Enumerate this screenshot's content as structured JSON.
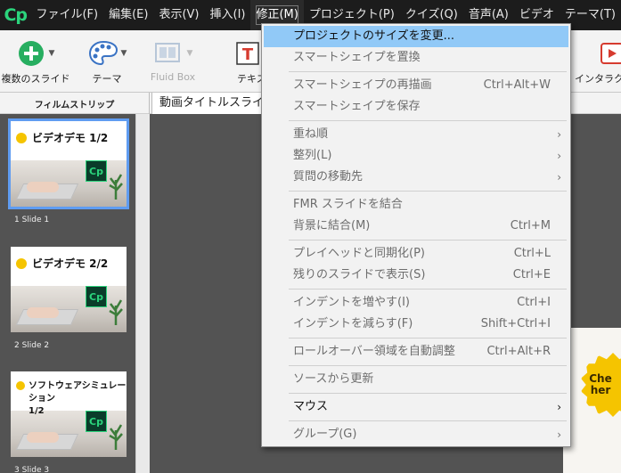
{
  "app": {
    "logo_text": "Cp"
  },
  "menubar": {
    "items": [
      {
        "label": "ファイル(F)"
      },
      {
        "label": "編集(E)"
      },
      {
        "label": "表示(V)"
      },
      {
        "label": "挿入(I)"
      },
      {
        "label": "修正(M)",
        "active": true
      },
      {
        "label": "プロジェクト(P)"
      },
      {
        "label": "クイズ(Q)"
      },
      {
        "label": "音声(A)"
      },
      {
        "label": "ビデオ"
      },
      {
        "label": "テーマ(T)"
      }
    ]
  },
  "toolbar": {
    "multi_slide_label": "複数のスライド",
    "theme_label": "テーマ",
    "fluid_box_label": "Fluid Box",
    "text_label": "テキスト",
    "interactive_label": "インタラクティ"
  },
  "subbar": {
    "filmstrip_header": "フィルムストリップ",
    "slide_tab": "動画タイトルスライド"
  },
  "filmstrip": {
    "slides": [
      {
        "title": "ビデオデモ 1/2",
        "label": "1 Slide 1",
        "selected": true
      },
      {
        "title": "ビデオデモ 2/2",
        "label": "2 Slide 2",
        "selected": false
      },
      {
        "title_line1": "ソフトウェアシミュレーション",
        "title_line2": "1/2",
        "label": "3 Slide 3",
        "selected": false
      }
    ],
    "badge_text": "Cp"
  },
  "canvas": {
    "badge_line1": "Che",
    "badge_line2": "her"
  },
  "dropdown": {
    "items": [
      {
        "label": "プロジェクトのサイズを変更...",
        "shortcut": "",
        "enabled": true,
        "highlight": true
      },
      {
        "label": "スマートシェイプを置換",
        "shortcut": "",
        "enabled": false
      },
      {
        "label": "スマートシェイプの再描画",
        "shortcut": "Ctrl+Alt+W",
        "enabled": false
      },
      {
        "label": "スマートシェイプを保存",
        "shortcut": "",
        "enabled": false
      },
      {
        "label": "重ね順",
        "shortcut": "",
        "enabled": false,
        "submenu": true
      },
      {
        "label": "整列(L)",
        "shortcut": "",
        "enabled": false,
        "submenu": true
      },
      {
        "label": "質問の移動先",
        "shortcut": "",
        "enabled": false,
        "submenu": true
      },
      {
        "label": "FMR スライドを結合",
        "shortcut": "",
        "enabled": false
      },
      {
        "label": "背景に結合(M)",
        "shortcut": "Ctrl+M",
        "enabled": false
      },
      {
        "label": "プレイヘッドと同期化(P)",
        "shortcut": "Ctrl+L",
        "enabled": false
      },
      {
        "label": "残りのスライドで表示(S)",
        "shortcut": "Ctrl+E",
        "enabled": false
      },
      {
        "label": "インデントを増やす(I)",
        "shortcut": "Ctrl+I",
        "enabled": false
      },
      {
        "label": "インデントを減らす(F)",
        "shortcut": "Shift+Ctrl+I",
        "enabled": false
      },
      {
        "label": "ロールオーバー領域を自動調整",
        "shortcut": "Ctrl+Alt+R",
        "enabled": false
      },
      {
        "label": "ソースから更新",
        "shortcut": "",
        "enabled": false
      },
      {
        "label": "マウス",
        "shortcut": "",
        "enabled": true,
        "submenu": true
      },
      {
        "label": "グループ(G)",
        "shortcut": "",
        "enabled": false,
        "submenu": true
      }
    ],
    "submenu_arrow": "›"
  },
  "colors": {
    "menubar_bg": "#1c1c1c",
    "highlight": "#91c9f7",
    "selected_outline": "#5f9cf1",
    "cp_green": "#2bd47c",
    "seal_yellow": "#f5c400"
  }
}
